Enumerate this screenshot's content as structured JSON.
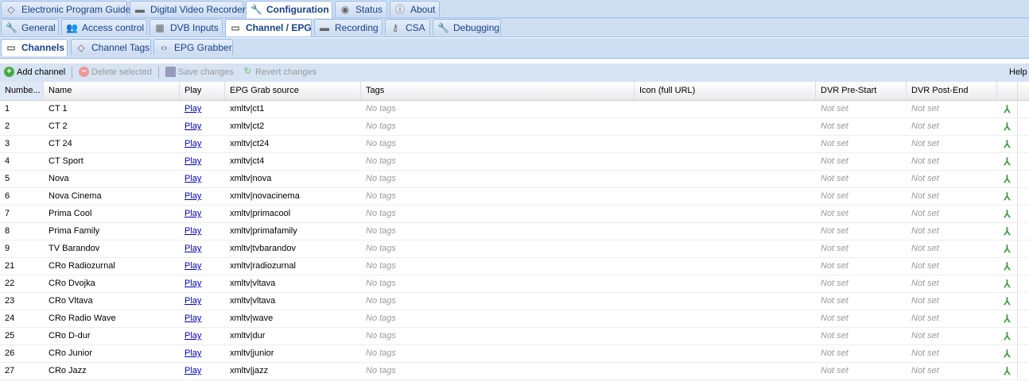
{
  "top_tabs": [
    {
      "label": "Electronic Program Guide",
      "icon": "tag-icon"
    },
    {
      "label": "Digital Video Recorder",
      "icon": "drive-icon"
    },
    {
      "label": "Configuration",
      "icon": "wrench-icon",
      "active": true
    },
    {
      "label": "Status",
      "icon": "eye-icon"
    },
    {
      "label": "About",
      "icon": "info-icon"
    }
  ],
  "config_tabs": [
    {
      "label": "General",
      "icon": "wrench-icon"
    },
    {
      "label": "Access control",
      "icon": "users-icon"
    },
    {
      "label": "DVB Inputs",
      "icon": "card-icon"
    },
    {
      "label": "Channel / EPG",
      "icon": "tv-icon",
      "active": true
    },
    {
      "label": "Recording",
      "icon": "drive-icon"
    },
    {
      "label": "CSA",
      "icon": "key-icon"
    },
    {
      "label": "Debugging",
      "icon": "wrench-icon"
    }
  ],
  "sub_tabs": [
    {
      "label": "Channels",
      "icon": "tv-icon",
      "active": true
    },
    {
      "label": "Channel Tags",
      "icon": "tag-icon"
    },
    {
      "label": "EPG Grabber",
      "icon": "code-icon"
    }
  ],
  "toolbar": {
    "add": "Add channel",
    "delete": "Delete selected",
    "save": "Save changes",
    "revert": "Revert changes",
    "help": "Help"
  },
  "columns": [
    "Numbe...",
    "Name",
    "Play",
    "EPG Grab source",
    "Tags",
    "Icon (full URL)",
    "DVR Pre-Start",
    "DVR Post-End"
  ],
  "play_label": "Play",
  "no_tags": "No tags",
  "not_set": "Not set",
  "rows": [
    [
      "1",
      "CT 1",
      "xmltv|ct1"
    ],
    [
      "2",
      "CT 2",
      "xmltv|ct2"
    ],
    [
      "3",
      "CT 24",
      "xmltv|ct24"
    ],
    [
      "4",
      "CT Sport",
      "xmltv|ct4"
    ],
    [
      "5",
      "Nova",
      "xmltv|nova"
    ],
    [
      "6",
      "Nova Cinema",
      "xmltv|novacinema"
    ],
    [
      "7",
      "Prima Cool",
      "xmltv|primacool"
    ],
    [
      "8",
      "Prima Family",
      "xmltv|primafamily"
    ],
    [
      "9",
      "TV Barandov",
      "xmltv|tvbarandov"
    ],
    [
      "21",
      "CRo Radiozurnal",
      "xmltv|radiozurnal"
    ],
    [
      "22",
      "CRo Dvojka",
      "xmltv|vltava"
    ],
    [
      "23",
      "CRo Vltava",
      "xmltv|vltava"
    ],
    [
      "24",
      "CRo Radio Wave",
      "xmltv|wave"
    ],
    [
      "25",
      "CRo D-dur",
      "xmltv|dur"
    ],
    [
      "26",
      "CRo Junior",
      "xmltv|junior"
    ],
    [
      "27",
      "CRo Jazz",
      "xmltv|jazz"
    ]
  ]
}
